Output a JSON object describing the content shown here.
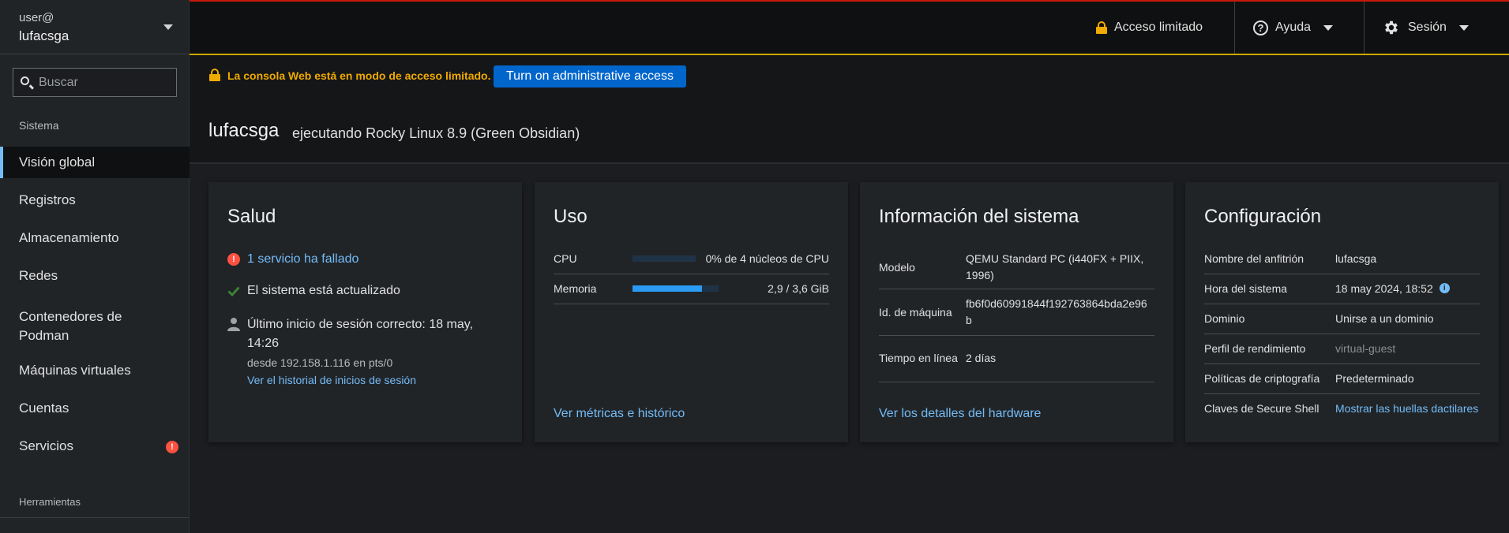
{
  "user": {
    "line1": "user@",
    "host": "lufacsga"
  },
  "search": {
    "placeholder": "Buscar"
  },
  "sidebar": {
    "section_system": "Sistema",
    "items": [
      {
        "label": "Visión global",
        "active": true
      },
      {
        "label": "Registros"
      },
      {
        "label": "Almacenamiento"
      },
      {
        "label": "Redes"
      },
      {
        "label": "Contenedores de Podman"
      },
      {
        "label": "Máquinas virtuales"
      },
      {
        "label": "Cuentas"
      },
      {
        "label": "Servicios",
        "badge": "!"
      }
    ],
    "section_tools": "Herramientas"
  },
  "topbar": {
    "limited_access": "Acceso limitado",
    "help": "Ayuda",
    "session": "Sesión"
  },
  "alert": {
    "text": "La consola Web está en modo de acceso limitado.",
    "button": "Turn on administrative access"
  },
  "header": {
    "hostname": "lufacsga",
    "description": "ejecutando Rocky Linux 8.9 (Green Obsidian)"
  },
  "health": {
    "title": "Salud",
    "failed": "1 servicio ha fallado",
    "updated": "El sistema está actualizado",
    "last_login": "Último inicio de sesión correcto: 18 may, 14:26",
    "last_login_from": "desde 192.158.1.116 en pts/0",
    "history_link": "Ver el historial de inicios de sesión"
  },
  "usage": {
    "title": "Uso",
    "cpu_label": "CPU",
    "cpu_value": "0% de 4 núcleos de CPU",
    "cpu_fraction": 0.0,
    "mem_label": "Memoria",
    "mem_value": "2,9 / 3,6 GiB",
    "mem_fraction": 0.81,
    "link": "Ver métricas e histórico"
  },
  "sysinfo": {
    "title": "Información del sistema",
    "model_label": "Modelo",
    "model_value": "QEMU Standard PC (i440FX + PIIX, 1996)",
    "machine_id_label": "Id. de máquina",
    "machine_id_value": "fb6f0d60991844f192763864bda2e96b",
    "uptime_label": "Tiempo en línea",
    "uptime_value": "2 días",
    "link": "Ver los detalles del hardware"
  },
  "config": {
    "title": "Configuración",
    "hostname_label": "Nombre del anfitrión",
    "hostname_value": "lufacsga",
    "time_label": "Hora del sistema",
    "time_value": "18 may 2024, 18:52",
    "domain_label": "Dominio",
    "domain_value": "Unirse a un dominio",
    "perf_label": "Perfil de rendimiento",
    "perf_value": "virtual-guest",
    "crypto_label": "Políticas de criptografía",
    "crypto_value": "Predeterminado",
    "ssh_label": "Claves de Secure Shell",
    "ssh_value": "Mostrar las huellas dactilares"
  },
  "colors": {
    "accent_blue": "#0066cc",
    "link": "#73bcf7",
    "warning": "#f0ab00",
    "danger": "#fe5142",
    "success": "#3e8635"
  }
}
